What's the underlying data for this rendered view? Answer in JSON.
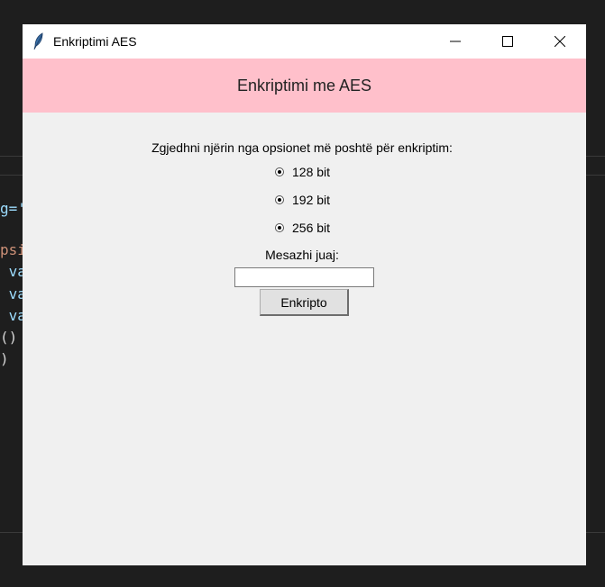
{
  "window": {
    "title": "Enkriptimi AES",
    "controls": [
      "minimize",
      "maximize",
      "close"
    ]
  },
  "header": {
    "title": "Enkriptimi me AES"
  },
  "form": {
    "prompt": "Zgjedhni njërin nga opsionet më poshtë për enkriptim:",
    "options": [
      {
        "label": "128 bit"
      },
      {
        "label": "192 bit"
      },
      {
        "label": "256 bit"
      }
    ],
    "message_label": "Mesazhi juaj:",
    "message_value": "",
    "button_label": "Enkripto"
  },
  "background_code": {
    "lines": [
      "g='",
      "psi",
      " va",
      " va",
      " va",
      "()",
      ")"
    ]
  },
  "colors": {
    "header_bg": "#ffc0cb",
    "window_bg": "#f0f0f0",
    "desktop_bg": "#1e1e1e"
  }
}
